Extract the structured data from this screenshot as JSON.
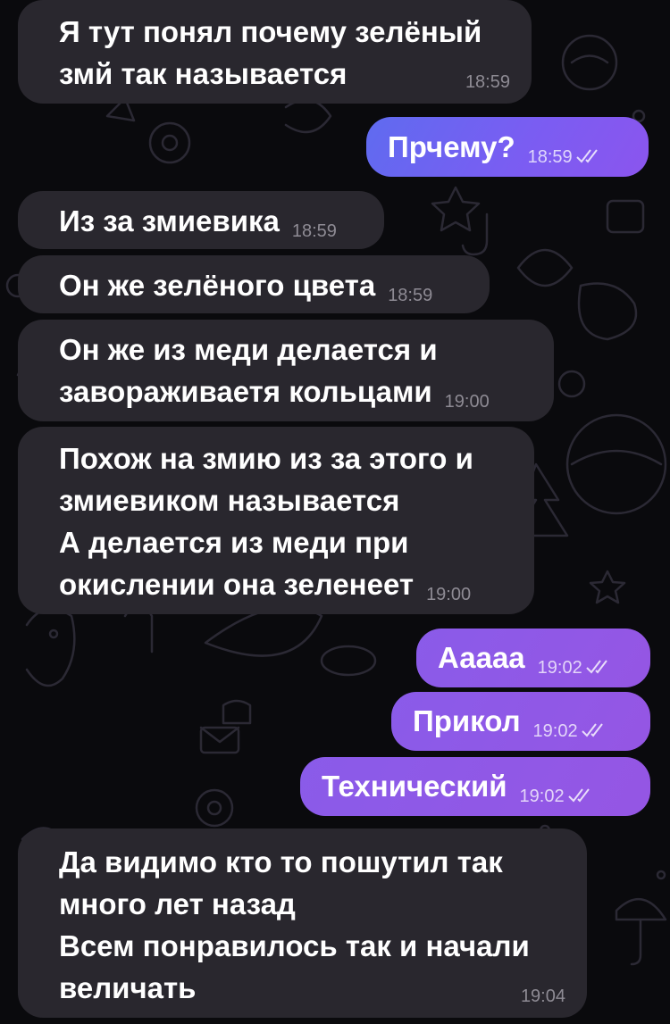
{
  "chat": {
    "messages": [
      {
        "direction": "in",
        "text": "Я тут понял почему зелёный\nзмй так называется",
        "time": "18:59"
      },
      {
        "direction": "out",
        "text": "Прчему?",
        "time": "18:59",
        "read": true
      },
      {
        "direction": "in",
        "text": "Из за змиевика",
        "time": "18:59"
      },
      {
        "direction": "in",
        "text": "Он же зелёного цвета",
        "time": "18:59"
      },
      {
        "direction": "in",
        "text": "Он же из меди делается и\nзавораживаетя кольцами",
        "time": "19:00"
      },
      {
        "direction": "in",
        "text": "Похож на змию из за этого и\nзмиевиком называется\nА делается из меди при\nокислении она зеленеет",
        "time": "19:00"
      },
      {
        "direction": "out",
        "text": "Ааааа",
        "time": "19:02",
        "read": true
      },
      {
        "direction": "out",
        "text": "Прикол",
        "time": "19:02",
        "read": true
      },
      {
        "direction": "out",
        "text": "Технический",
        "time": "19:02",
        "read": true
      },
      {
        "direction": "in",
        "text": "Да видимо кто то пошутил так\nмного лет назад\nВсем понравилось так и начали\nвеличать",
        "time": "19:04"
      }
    ]
  },
  "colors": {
    "background": "#0a0a0d",
    "incoming_bubble": "#29272e",
    "outgoing_bubble_start": "#5f6bf0",
    "outgoing_bubble_end": "#8b55ee"
  },
  "icons": {
    "read_receipt": "double-check-icon",
    "wallpaper": "doodle-pattern"
  }
}
